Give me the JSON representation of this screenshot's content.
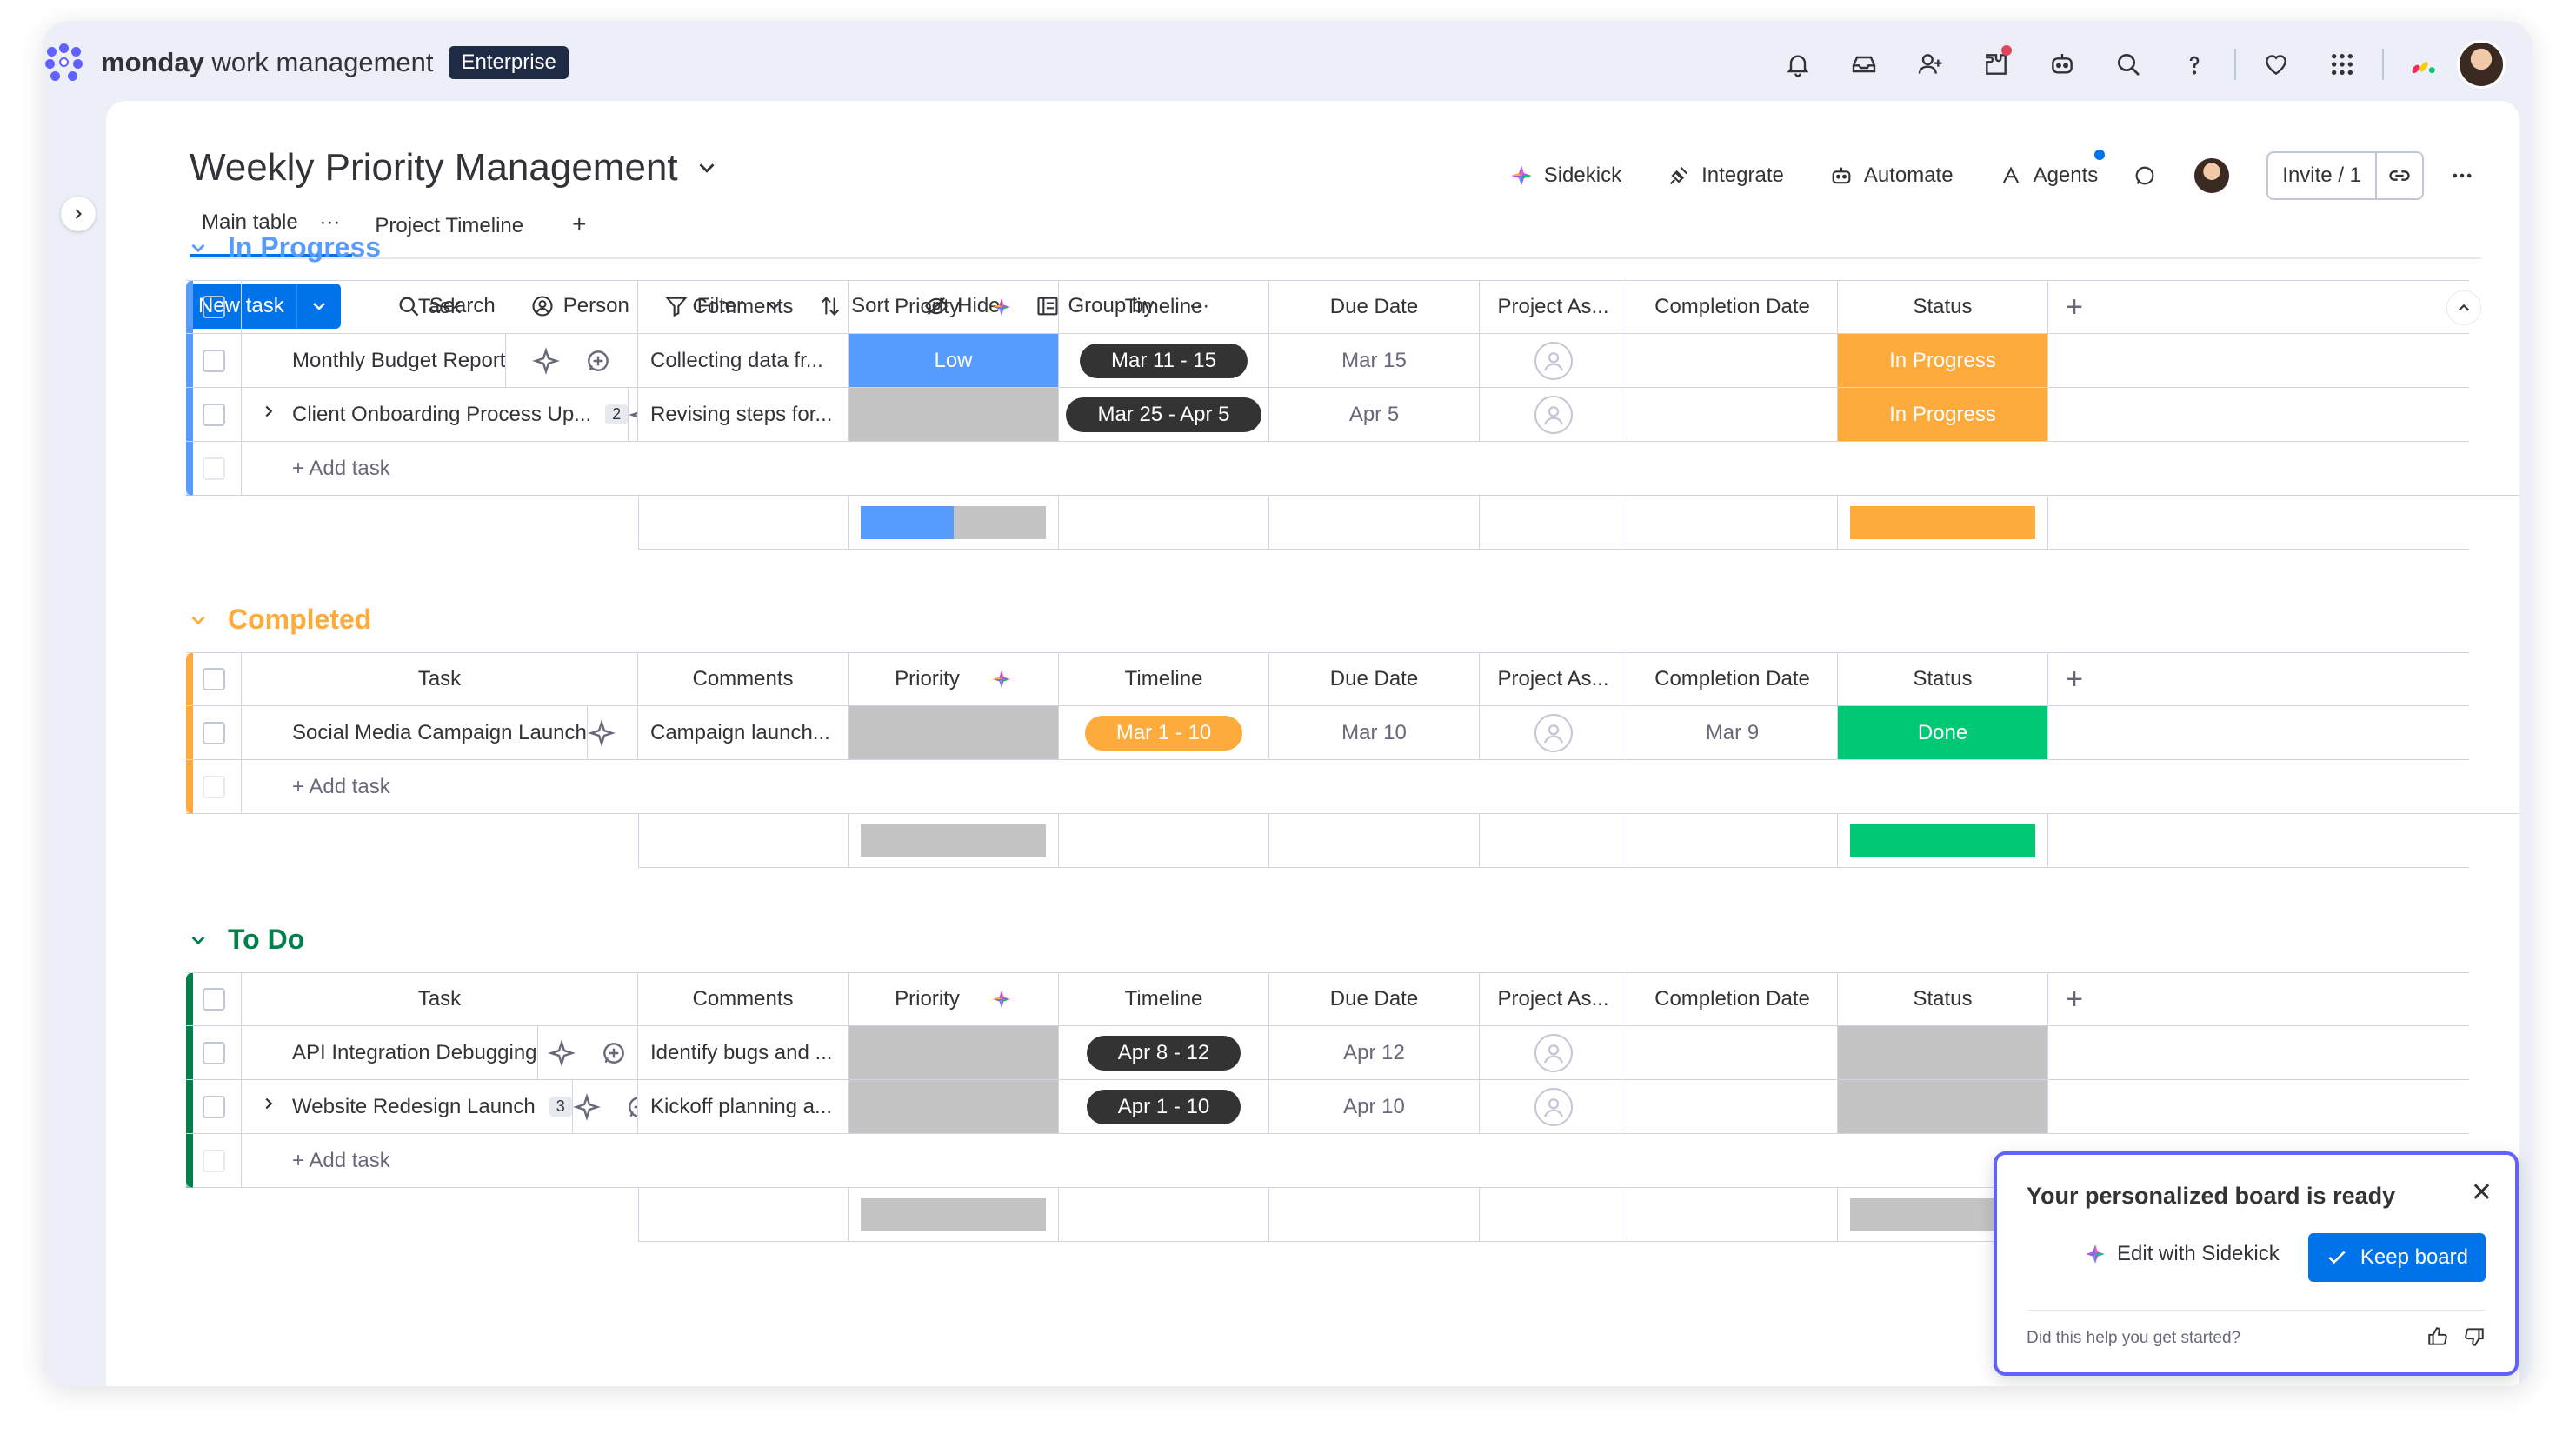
{
  "topbar": {
    "brand_bold": "monday",
    "brand_rest": " work management",
    "badge": "Enterprise"
  },
  "board": {
    "title": "Weekly Priority Management",
    "actions": {
      "sidekick": "Sidekick",
      "integrate": "Integrate",
      "automate": "Automate",
      "agents": "Agents",
      "invite": "Invite / 1"
    },
    "tabs": [
      "Main table",
      "Project Timeline"
    ],
    "tab_more": "···",
    "tab_add": "+"
  },
  "toolbar": {
    "new_task": "New task",
    "search": "Search",
    "person": "Person",
    "filter": "Filter",
    "sort": "Sort",
    "hide": "Hide",
    "group_by": "Group by",
    "more": "···"
  },
  "columns": {
    "task": "Task",
    "comments": "Comments",
    "priority": "Priority",
    "timeline": "Timeline",
    "due_date": "Due Date",
    "project_assignee": "Project As...",
    "completion_date": "Completion Date",
    "status": "Status",
    "add": "+"
  },
  "add_task": "+ Add task",
  "groups": [
    {
      "title": "In Progress",
      "color": "#579bfc",
      "rows": [
        {
          "task": "Monthly Budget Report",
          "subitems": "",
          "comments": "Collecting data fr...",
          "priority": "Low",
          "priority_color": "#579bfc",
          "timeline": "Mar 11 - 15",
          "timeline_color": "#333333",
          "due": "Mar 15",
          "completion": "",
          "status": "In Progress",
          "status_color": "#fdab3d"
        },
        {
          "task": "Client Onboarding Process Up...",
          "subitems": "2",
          "comments": "Revising steps for...",
          "priority": "",
          "priority_color": "#c4c4c4",
          "timeline": "Mar 25 - Apr 5",
          "timeline_color": "#333333",
          "due": "Apr 5",
          "completion": "",
          "status": "In Progress",
          "status_color": "#fdab3d"
        }
      ],
      "summary": {
        "priority_fill": 0.5,
        "priority_color": "#579bfc",
        "status_color": "#fdab3d"
      }
    },
    {
      "title": "Completed",
      "color": "#fdab3d",
      "rows": [
        {
          "task": "Social Media Campaign Launch",
          "subitems": "",
          "comments": "Campaign launch...",
          "priority": "",
          "priority_color": "#c4c4c4",
          "timeline": "Mar 1 - 10",
          "timeline_color": "#fdab3d",
          "due": "Mar 10",
          "completion": "Mar 9",
          "status": "Done",
          "status_color": "#00c875"
        }
      ],
      "summary": {
        "priority_fill": 0,
        "priority_color": "#c4c4c4",
        "status_color": "#00c875"
      }
    },
    {
      "title": "To Do",
      "color": "#037f4c",
      "rows": [
        {
          "task": "API Integration Debugging",
          "subitems": "",
          "comments": "Identify bugs and ...",
          "priority": "",
          "priority_color": "#c4c4c4",
          "timeline": "Apr 8 - 12",
          "timeline_color": "#333333",
          "due": "Apr 12",
          "completion": "",
          "status": "",
          "status_color": "#c4c4c4"
        },
        {
          "task": "Website Redesign Launch",
          "subitems": "3",
          "comments": "Kickoff planning a...",
          "priority": "",
          "priority_color": "#c4c4c4",
          "timeline": "Apr 1 - 10",
          "timeline_color": "#333333",
          "due": "Apr 10",
          "completion": "",
          "status": "",
          "status_color": "#c4c4c4"
        }
      ],
      "summary": {
        "priority_fill": 0,
        "priority_color": "#c4c4c4",
        "status_color": "#c4c4c4"
      }
    }
  ],
  "popup": {
    "title": "Your personalized board is ready",
    "edit": "Edit with Sidekick",
    "keep": "Keep board",
    "help": "Did this help you get started?"
  }
}
